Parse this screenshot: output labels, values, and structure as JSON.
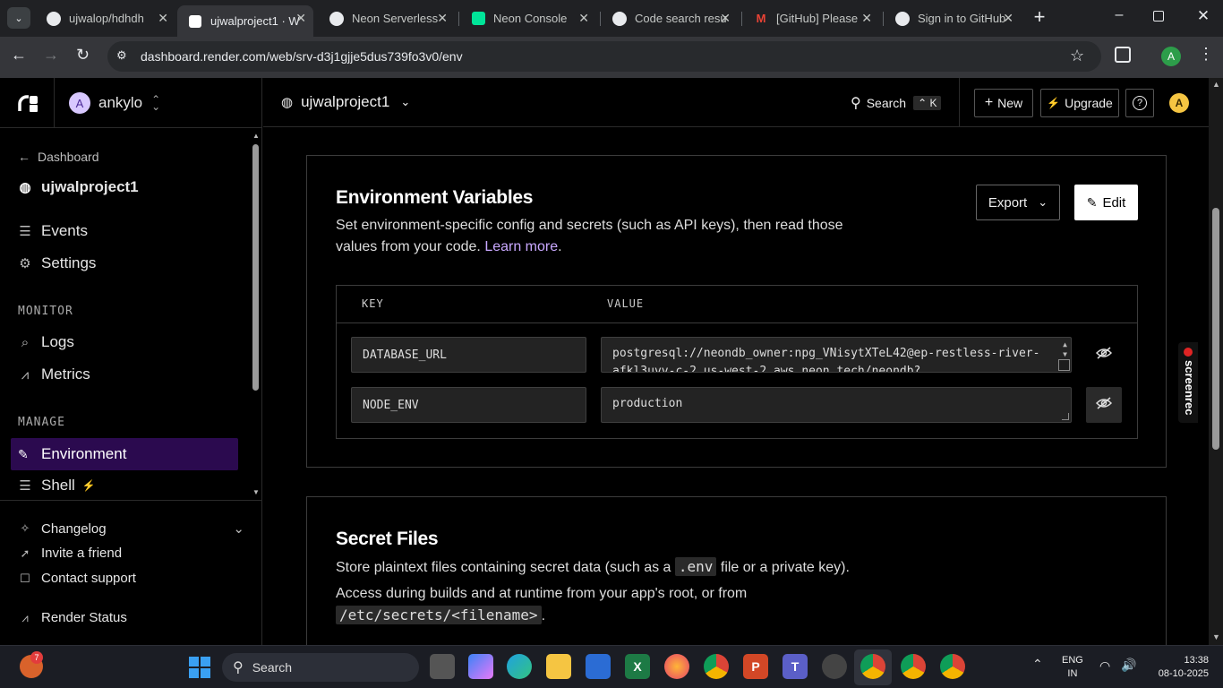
{
  "browser": {
    "tabs": [
      {
        "title": "ujwalop/hdhdh",
        "icon": "github-icon"
      },
      {
        "title": "ujwalproject1 · W",
        "icon": "render-icon",
        "active": true
      },
      {
        "title": "Neon Serverless",
        "icon": "github-icon"
      },
      {
        "title": "Neon Console",
        "icon": "neon-icon"
      },
      {
        "title": "Code search resu",
        "icon": "github-icon"
      },
      {
        "title": "[GitHub] Please",
        "icon": "gmail-icon"
      },
      {
        "title": "Sign in to GitHub",
        "icon": "github-icon"
      }
    ],
    "url": "dashboard.render.com/web/srv-d3j1gjje5dus739fo3v0/env",
    "profile_initial": "A"
  },
  "workspace": {
    "initial": "A",
    "name": "ankylo"
  },
  "project": {
    "name": "ujwalproject1"
  },
  "topbar": {
    "search_label": "Search",
    "search_shortcut": "K",
    "new_label": "New",
    "upgrade_label": "Upgrade",
    "avatar_initial": "A"
  },
  "sidebar": {
    "back_label": "Dashboard",
    "service_name": "ujwalproject1",
    "items_top": [
      {
        "label": "Events",
        "icon": "list-icon"
      },
      {
        "label": "Settings",
        "icon": "gear-icon"
      }
    ],
    "monitor_heading": "MONITOR",
    "monitor_items": [
      {
        "label": "Logs",
        "icon": "logs-icon"
      },
      {
        "label": "Metrics",
        "icon": "chart-icon"
      }
    ],
    "manage_heading": "MANAGE",
    "manage_items": [
      {
        "label": "Environment",
        "icon": "edit-icon",
        "active": true
      },
      {
        "label": "Shell",
        "icon": "terminal-icon"
      }
    ],
    "footer_items": [
      {
        "label": "Changelog",
        "icon": "star-icon"
      },
      {
        "label": "Invite a friend",
        "icon": "send-icon"
      },
      {
        "label": "Contact support",
        "icon": "chat-icon"
      },
      {
        "label": "Render Status",
        "icon": "pulse-icon"
      }
    ]
  },
  "env_section": {
    "title": "Environment Variables",
    "description": "Set environment-specific config and secrets (such as API keys), then read those values from your code.",
    "learn_more": "Learn more",
    "export_label": "Export",
    "edit_label": "Edit",
    "key_header": "KEY",
    "value_header": "VALUE",
    "rows": [
      {
        "key": "DATABASE_URL",
        "value": "postgresql://neondb_owner:npg_VNisytXTeL42@ep-restless-river-afkl3uvv-c-2.us-west-2.aws.neon.tech/neondb?"
      },
      {
        "key": "NODE_ENV",
        "value": "production"
      }
    ]
  },
  "secret_section": {
    "title": "Secret Files",
    "desc_before": "Store plaintext files containing secret data (such as a",
    "desc_code": ".env",
    "desc_after": "file or a private key).",
    "access_text": "Access during builds and at runtime from your app's root, or from",
    "path_code": "/etc/secrets/<filename>",
    "path_after": "."
  },
  "screenrec_label": "screenrec",
  "taskbar": {
    "search_label": "Search",
    "widget_badge": "7",
    "lang_top": "ENG",
    "lang_bottom": "IN",
    "time": "13:38",
    "date": "08-10-2025"
  }
}
